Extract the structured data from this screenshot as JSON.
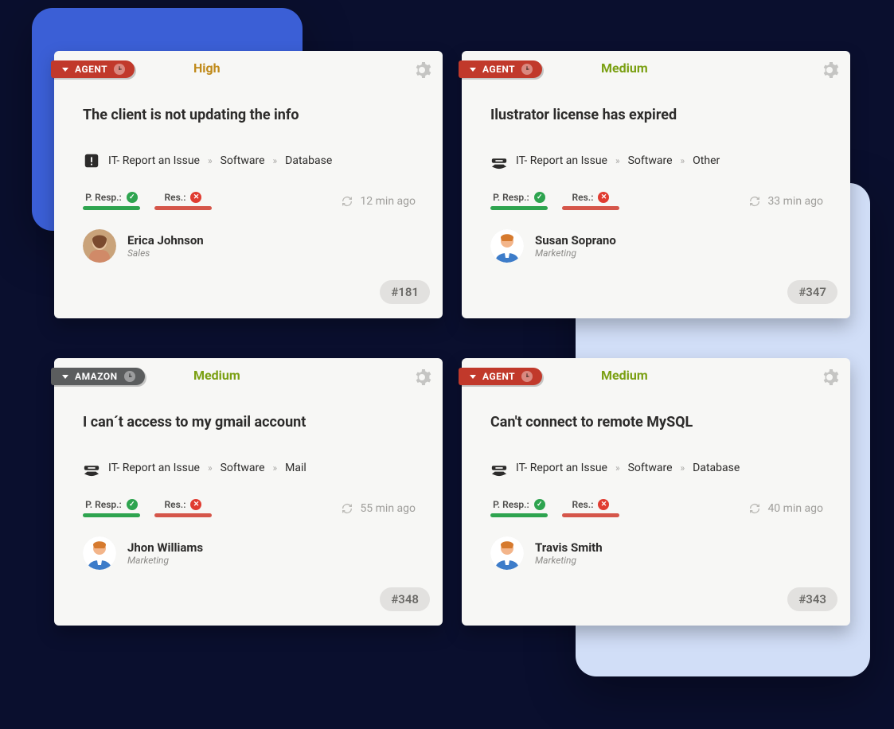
{
  "colors": {
    "brand_primary": "#3b5fd6",
    "brand_secondary": "#d1def7",
    "badge_red": "#c1392b",
    "badge_gray": "#5b5d5e",
    "priority_high": "#c08a1a",
    "priority_medium": "#7ba013"
  },
  "labels": {
    "p_resp": "P. Resp.:",
    "res": "Res.:"
  },
  "cards": [
    {
      "badge": {
        "label": "AGENT",
        "color": "red"
      },
      "priority": {
        "label": "High",
        "level": "high"
      },
      "title": "The client is not updating the info",
      "service_icon": "alert",
      "crumbs": [
        "IT- Report an Issue",
        "Software",
        "Database"
      ],
      "p_resp": "ok",
      "res": "fail",
      "timestamp": "12 min ago",
      "user": {
        "name": "Erica Johnson",
        "dept": "Sales",
        "avatar": "photo"
      },
      "ticket_id": "#181"
    },
    {
      "badge": {
        "label": "AGENT",
        "color": "red"
      },
      "priority": {
        "label": "Medium",
        "level": "medium"
      },
      "title": "Ilustrator license has expired",
      "service_icon": "service",
      "crumbs": [
        "IT- Report an Issue",
        "Software",
        "Other"
      ],
      "p_resp": "ok",
      "res": "fail",
      "timestamp": "33 min ago",
      "user": {
        "name": "Susan Soprano",
        "dept": "Marketing",
        "avatar": "generic"
      },
      "ticket_id": "#347"
    },
    {
      "badge": {
        "label": "AMAZON",
        "color": "gray"
      },
      "priority": {
        "label": "Medium",
        "level": "medium"
      },
      "title": "I can´t access to my gmail account",
      "service_icon": "service",
      "crumbs": [
        "IT- Report an Issue",
        "Software",
        "Mail"
      ],
      "p_resp": "ok",
      "res": "fail",
      "timestamp": "55 min ago",
      "user": {
        "name": "Jhon Williams",
        "dept": "Marketing",
        "avatar": "generic"
      },
      "ticket_id": "#348"
    },
    {
      "badge": {
        "label": "AGENT",
        "color": "red"
      },
      "priority": {
        "label": "Medium",
        "level": "medium"
      },
      "title": "Can't connect to remote MySQL",
      "service_icon": "service",
      "crumbs": [
        "IT- Report an Issue",
        "Software",
        "Database"
      ],
      "p_resp": "ok",
      "res": "fail",
      "timestamp": "40 min ago",
      "user": {
        "name": "Travis Smith",
        "dept": "Marketing",
        "avatar": "generic"
      },
      "ticket_id": "#343"
    }
  ]
}
